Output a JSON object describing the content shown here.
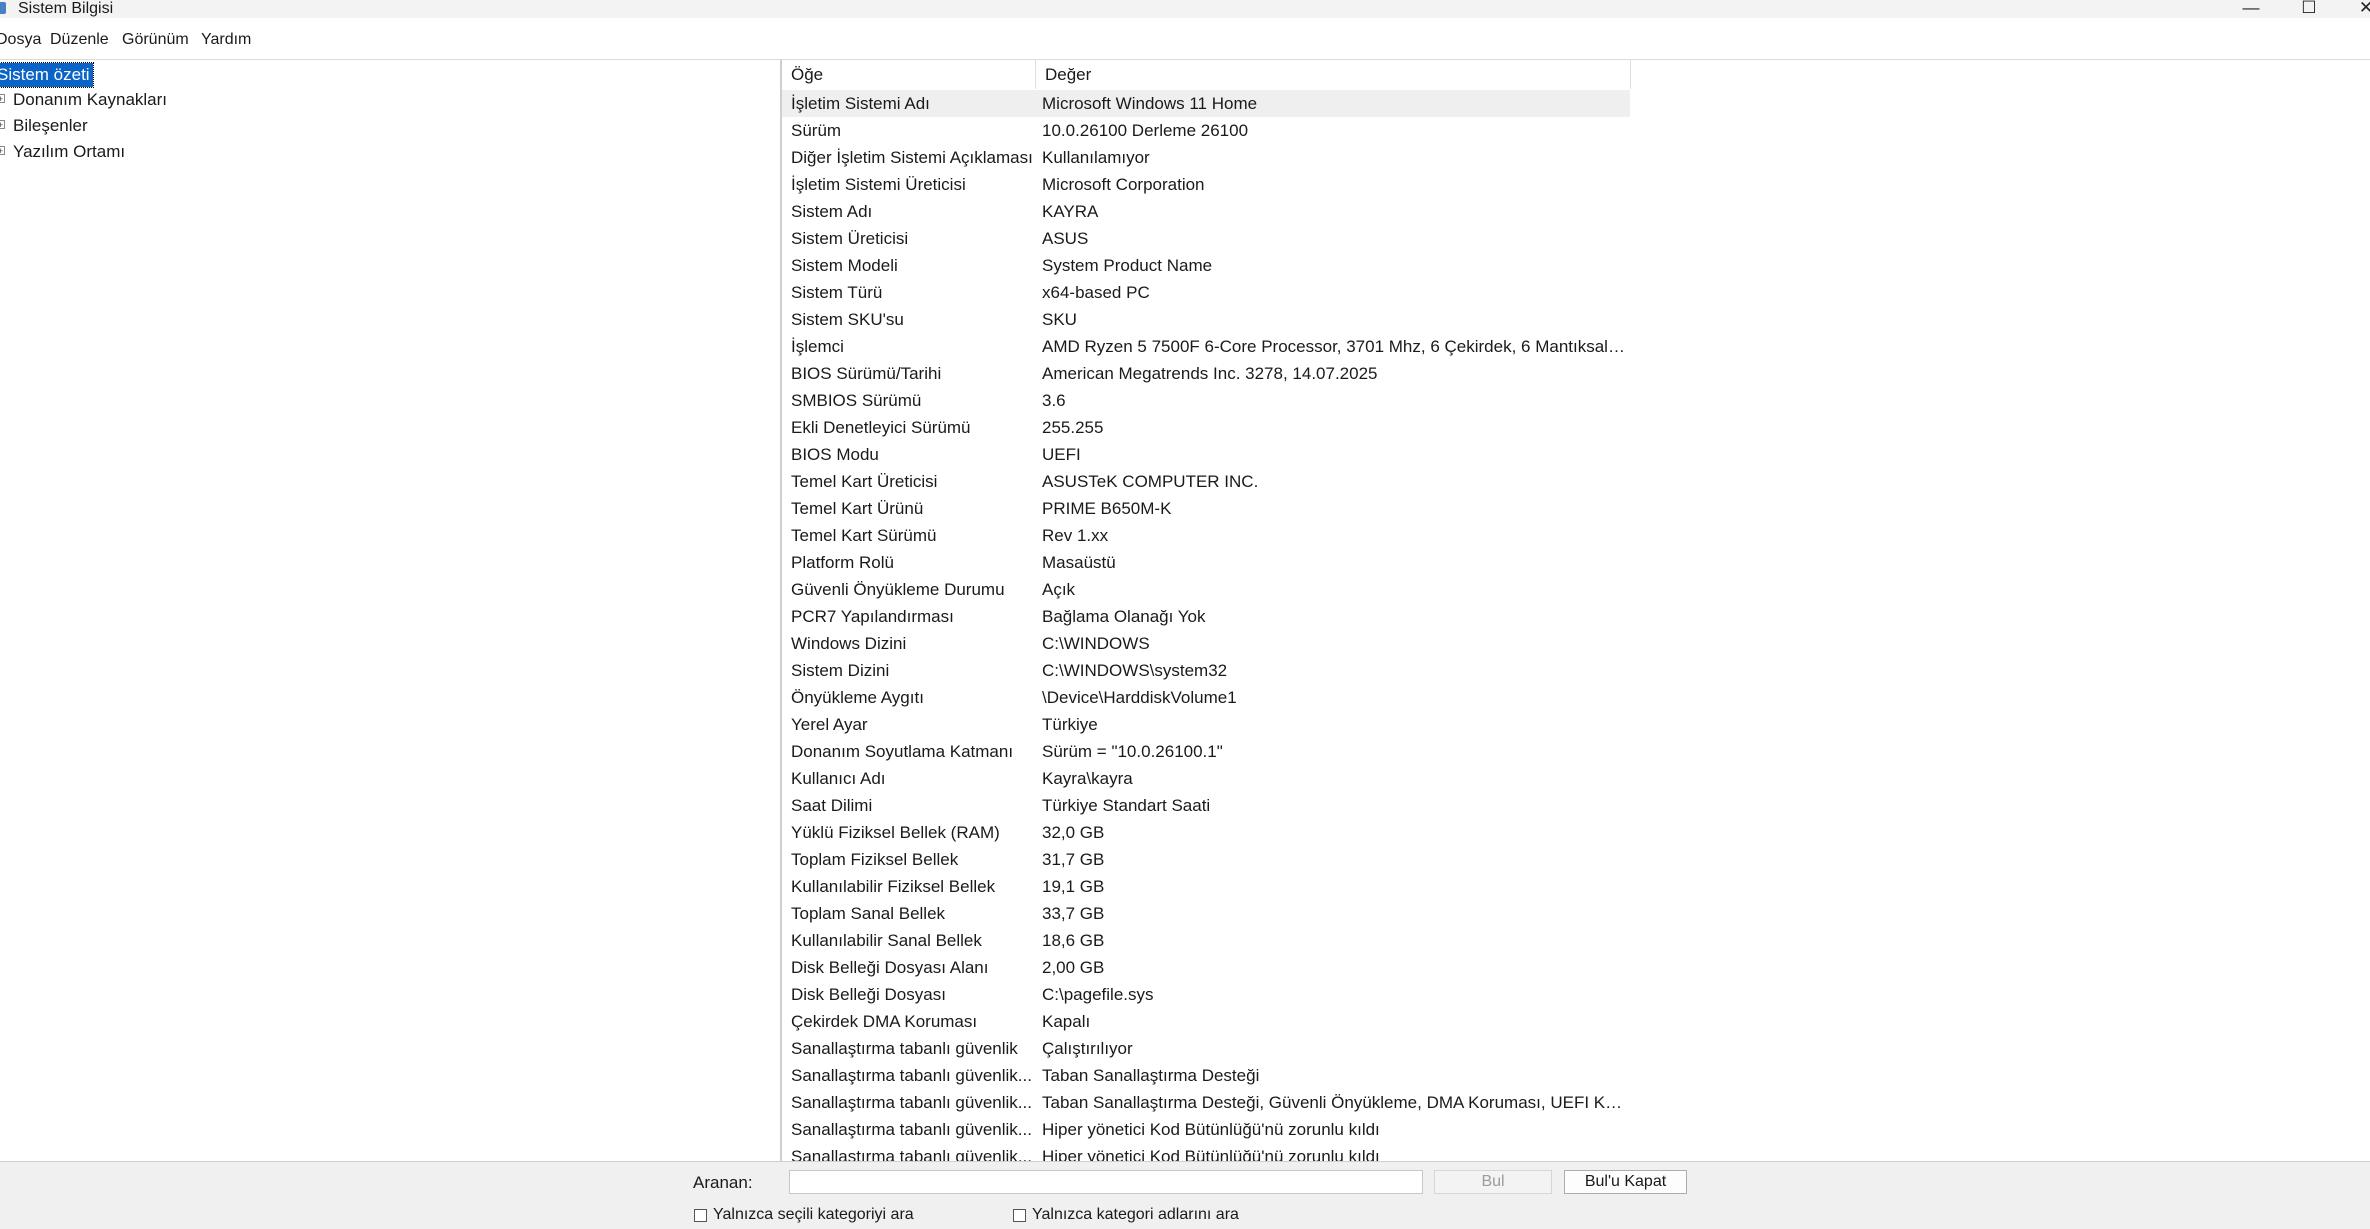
{
  "window": {
    "title": "Sistem Bilgisi",
    "minimize_glyph": "—",
    "maximize_glyph": "☐",
    "close_glyph": "✕"
  },
  "menu": [
    "Dosya",
    "Düzenle",
    "Görünüm",
    "Yardım"
  ],
  "tree": {
    "root": "Sistem özeti",
    "items": [
      {
        "label": "Donanım Kaynakları",
        "expander": "+"
      },
      {
        "label": "Bileşenler",
        "expander": "+"
      },
      {
        "label": "Yazılım Ortamı",
        "expander": "+"
      }
    ]
  },
  "grid": {
    "columns": {
      "item": "Öğe",
      "value": "Değer"
    },
    "rows": [
      {
        "item": "İşletim Sistemi Adı",
        "value": "Microsoft Windows 11 Home"
      },
      {
        "item": "Sürüm",
        "value": "10.0.26100 Derleme 26100"
      },
      {
        "item": "Diğer İşletim Sistemi Açıklaması",
        "value": "Kullanılamıyor"
      },
      {
        "item": "İşletim Sistemi Üreticisi",
        "value": "Microsoft Corporation"
      },
      {
        "item": "Sistem Adı",
        "value": "KAYRA"
      },
      {
        "item": "Sistem Üreticisi",
        "value": "ASUS"
      },
      {
        "item": "Sistem Modeli",
        "value": "System Product Name"
      },
      {
        "item": "Sistem Türü",
        "value": "x64-based PC"
      },
      {
        "item": "Sistem SKU'su",
        "value": "SKU"
      },
      {
        "item": "İşlemci",
        "value": "AMD Ryzen 5 7500F 6-Core Processor, 3701 Mhz, 6 Çekirdek, 6 Mantıksal İş..."
      },
      {
        "item": "BIOS Sürümü/Tarihi",
        "value": "American Megatrends Inc. 3278, 14.07.2025"
      },
      {
        "item": "SMBIOS Sürümü",
        "value": "3.6"
      },
      {
        "item": "Ekli Denetleyici Sürümü",
        "value": "255.255"
      },
      {
        "item": "BIOS Modu",
        "value": "UEFI"
      },
      {
        "item": "Temel Kart Üreticisi",
        "value": "ASUSTeK COMPUTER INC."
      },
      {
        "item": "Temel Kart Ürünü",
        "value": "PRIME B650M-K"
      },
      {
        "item": "Temel Kart Sürümü",
        "value": "Rev 1.xx"
      },
      {
        "item": "Platform Rolü",
        "value": "Masaüstü"
      },
      {
        "item": "Güvenli Önyükleme Durumu",
        "value": "Açık"
      },
      {
        "item": "PCR7 Yapılandırması",
        "value": "Bağlama Olanağı Yok"
      },
      {
        "item": "Windows Dizini",
        "value": "C:\\WINDOWS"
      },
      {
        "item": "Sistem Dizini",
        "value": "C:\\WINDOWS\\system32"
      },
      {
        "item": "Önyükleme Aygıtı",
        "value": "\\Device\\HarddiskVolume1"
      },
      {
        "item": "Yerel Ayar",
        "value": "Türkiye"
      },
      {
        "item": "Donanım Soyutlama Katmanı",
        "value": "Sürüm = \"10.0.26100.1\""
      },
      {
        "item": "Kullanıcı Adı",
        "value": "Kayra\\kayra"
      },
      {
        "item": "Saat Dilimi",
        "value": "Türkiye Standart Saati"
      },
      {
        "item": "Yüklü Fiziksel Bellek (RAM)",
        "value": "32,0 GB"
      },
      {
        "item": "Toplam Fiziksel Bellek",
        "value": "31,7 GB"
      },
      {
        "item": "Kullanılabilir Fiziksel Bellek",
        "value": "19,1 GB"
      },
      {
        "item": "Toplam Sanal Bellek",
        "value": "33,7 GB"
      },
      {
        "item": "Kullanılabilir Sanal Bellek",
        "value": "18,6 GB"
      },
      {
        "item": "Disk Belleği Dosyası Alanı",
        "value": "2,00 GB"
      },
      {
        "item": "Disk Belleği Dosyası",
        "value": "C:\\pagefile.sys"
      },
      {
        "item": "Çekirdek DMA Koruması",
        "value": "Kapalı"
      },
      {
        "item": "Sanallaştırma tabanlı güvenlik",
        "value": "Çalıştırılıyor"
      },
      {
        "item": "Sanallaştırma tabanlı güvenlik...",
        "value": "Taban Sanallaştırma Desteği"
      },
      {
        "item": "Sanallaştırma tabanlı güvenlik...",
        "value": "Taban Sanallaştırma Desteği, Güvenli Önyükleme, DMA Koruması, UEFI Ko..."
      },
      {
        "item": "Sanallaştırma tabanlı güvenlik...",
        "value": "Hiper yönetici Kod Bütünlüğü'nü zorunlu kıldı"
      },
      {
        "item": "Sanallaştırma tabanlı güvenlik...",
        "value": "Hiper yönetici Kod Bütünlüğü'nü zorunlu kıldı"
      }
    ]
  },
  "find": {
    "label": "Aranan:",
    "input_value": "",
    "find_button": "Bul",
    "close_button": "Bul'u Kapat",
    "checkbox_selected_category": "Yalnızca seçili kategoriyi ara",
    "checkbox_category_names": "Yalnızca kategori adlarını ara"
  }
}
